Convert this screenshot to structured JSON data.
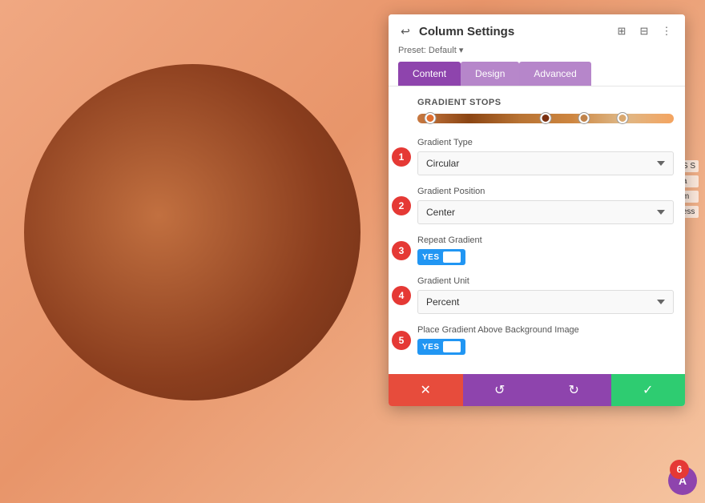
{
  "canvas": {
    "bg_gradient": "linear-gradient(135deg, #f0a882, #e8956a, #f5c4a0)"
  },
  "panel": {
    "title": "Column Settings",
    "preset_label": "Preset: Default ▾",
    "tabs": [
      {
        "id": "content",
        "label": "Content",
        "active": true
      },
      {
        "id": "design",
        "label": "Design",
        "active": false
      },
      {
        "id": "advanced",
        "label": "Advanced",
        "active": false
      }
    ],
    "sections": {
      "gradient_stops_label": "Gradient Stops",
      "gradient_type_label": "Gradient Type",
      "gradient_type_value": "Circular",
      "gradient_position_label": "Gradient Position",
      "gradient_position_value": "Center",
      "repeat_gradient_label": "Repeat Gradient",
      "repeat_gradient_yes": "YES",
      "gradient_unit_label": "Gradient Unit",
      "gradient_unit_value": "Percent",
      "place_gradient_label": "Place Gradient Above Background Image",
      "place_gradient_yes": "YES"
    },
    "badges": [
      "1",
      "2",
      "3",
      "4",
      "5",
      "6"
    ],
    "footer": {
      "cancel_icon": "✕",
      "reset_icon": "↺",
      "redo_icon": "↻",
      "save_icon": "✓"
    }
  }
}
